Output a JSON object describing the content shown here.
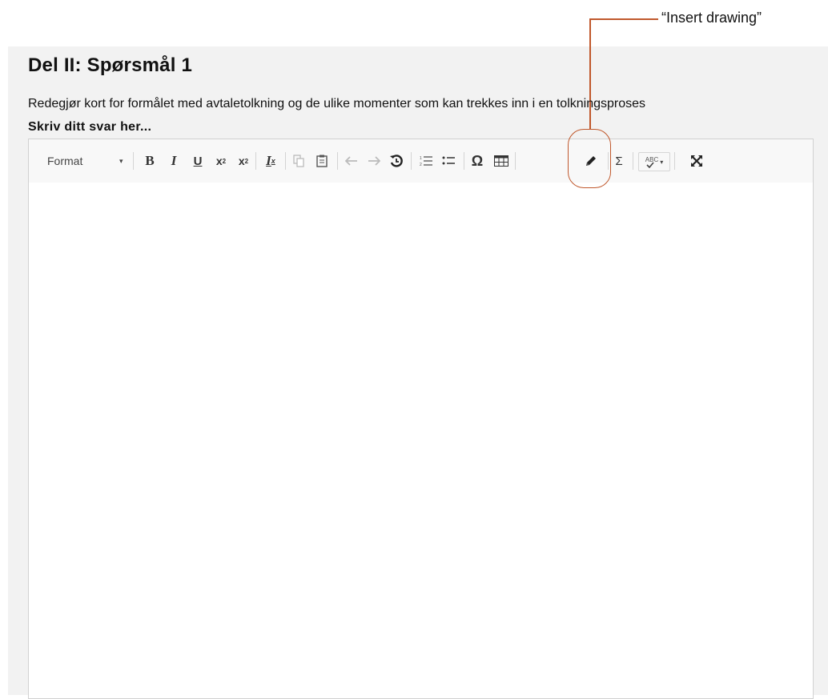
{
  "question": {
    "title": "Del II: Spørsmål 1",
    "prompt": "Redegjør kort for formålet med avtaletolkning og de ulike momenter som kan trekkes inn i en tolkningsproses",
    "answer_label": "Skriv ditt svar her..."
  },
  "toolbar": {
    "format_label": "Format",
    "format_caret": "▾",
    "bold": "B",
    "italic": "I",
    "underline": "U",
    "subscript": "x",
    "subscript_mark": "2",
    "superscript": "x",
    "superscript_mark": "2",
    "remove_format": "I",
    "remove_format_mark": "x",
    "copy_icon": "⎘",
    "paste_icon": "📋",
    "undo_icon": "⬅",
    "redo_icon": "➡",
    "history_icon": "↺",
    "numbered_list_icon": "≔",
    "bullet_list_icon": "⁝≡",
    "special_char": "Ω",
    "table_icon": "▦",
    "draw_icon": "✏",
    "sigma": "Σ",
    "spellcheck": "ABC",
    "spellcheck_caret": "▾",
    "maximize_icon": "⤧"
  },
  "annotation": {
    "label": "“Insert drawing”",
    "color": "#c0582c"
  }
}
